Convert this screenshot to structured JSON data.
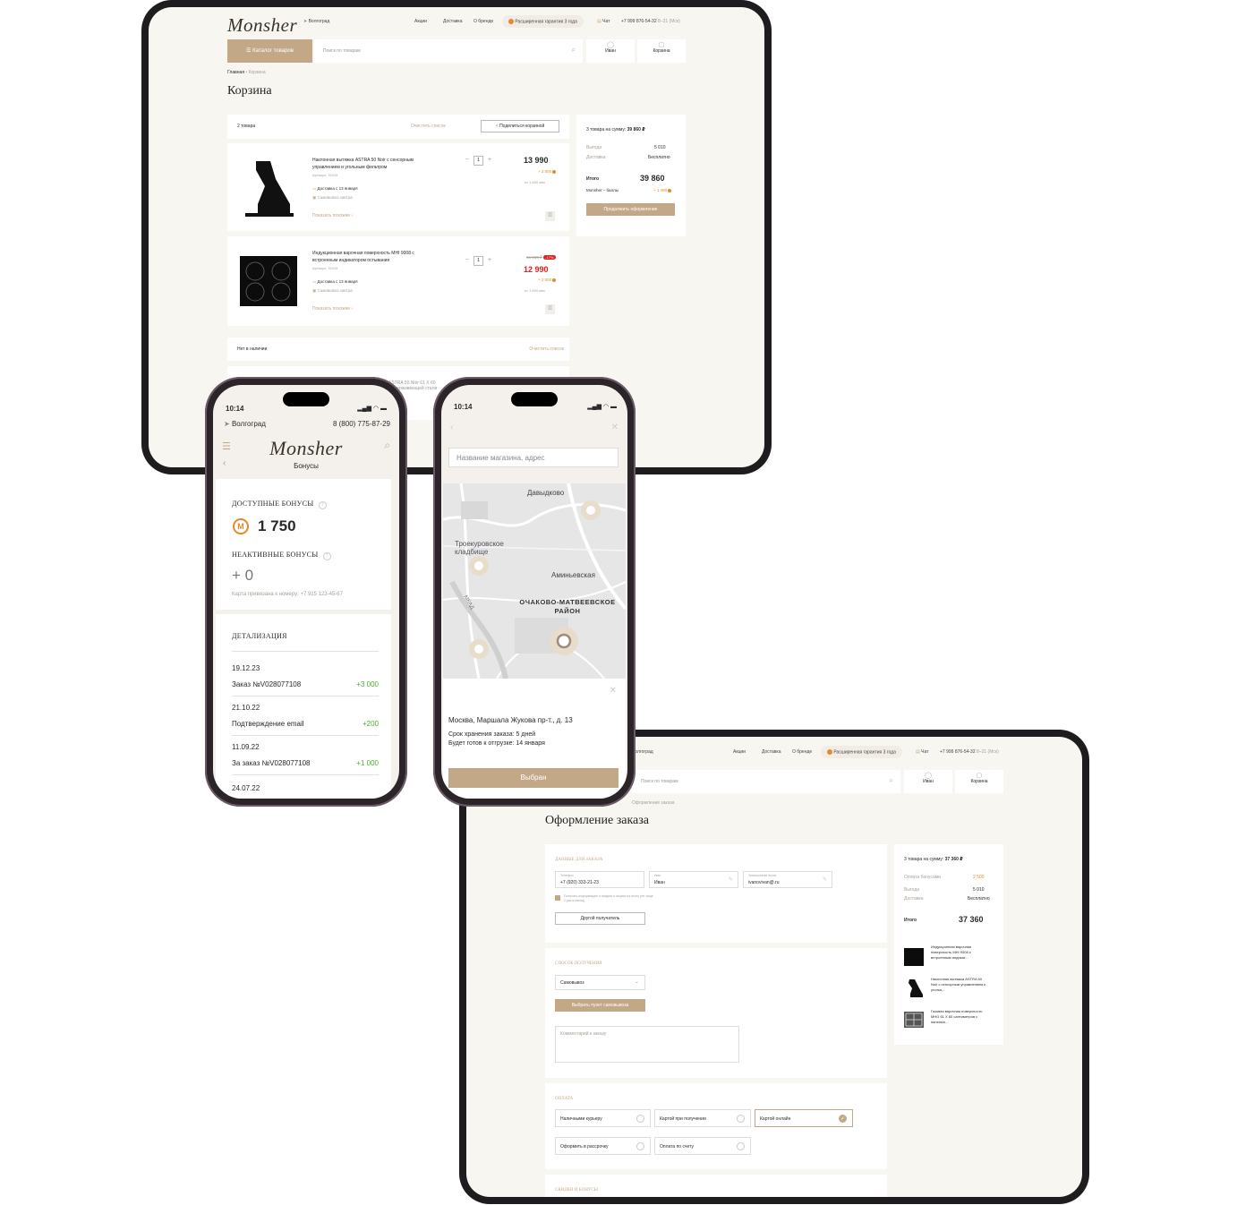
{
  "cart_page": {
    "logo": "Monsher",
    "city": "Волгоград",
    "nav": [
      "Акции",
      "Доставка",
      "О бренде"
    ],
    "warranty": "Расширенная гарантия 3 года",
    "chat": "Чат",
    "phone": "+7 999 876-54-32",
    "hours": "8–21 (Мск)",
    "catalog": "Каталог товаров",
    "search_placeholder": "Поиск по товарам",
    "user": "Иван",
    "cart": "Корзина",
    "breadcrumb_home": "Главная",
    "breadcrumb_current": "Корзина",
    "title": "Корзина",
    "items_count": "2 товара",
    "clear_list": "Очистить список",
    "share_cart": "Поделиться корзиной",
    "items": [
      {
        "name": "Наклонная вытяжка ASTRA 50 Noir с сенсорным управлением и угольным фильтром",
        "sku": "Артикул: 76243",
        "delivery": "Доставка с 13 января",
        "pickup": "Самовывоз завтра",
        "similar": "Показать похожие",
        "qty": "1",
        "price": "13 990",
        "old_price": "",
        "discount": "",
        "bonus": "+ 2 000",
        "installment": "от 1 890 мес"
      },
      {
        "name": "Индукционная варочная поверхность MHI 9008 с встроенным индикатором остывания",
        "sku": "Артикул: 76243",
        "delivery": "Доставка с 13 января",
        "pickup": "Самовывоз завтра",
        "similar": "Показать похожие",
        "qty": "1",
        "price": "12 990",
        "old_price": "16 990 ₽",
        "discount": "-17%",
        "bonus": "+ 2 000",
        "installment": "от 1 890 мес"
      }
    ],
    "not_available": "Нет в наличии",
    "clear_list_2": "Очистить список",
    "summary": {
      "total_label": "3 товара на сумму:",
      "total_value": "39 860 ₽",
      "benefit_label": "Выгода",
      "benefit_value": "5 010",
      "delivery_label": "Доставка",
      "delivery_value": "Бесплатно",
      "itogo_label": "Итого",
      "itogo_value": "39 860",
      "bonus_label": "Monsher – баллы",
      "bonus_value": "+ 1 490",
      "continue": "Продолжить оформление"
    },
    "peek_text_1": "ASTRA 50 Noir 61 X 60",
    "peek_text_2": "из нержавеющей стали"
  },
  "phone_bonus": {
    "time": "10:14",
    "city": "Волгоград",
    "phone": "8 (800) 775-87-29",
    "logo": "Monsher",
    "subtitle": "Бонусы",
    "available_label": "доступные бонусы",
    "available_value": "1 750",
    "inactive_label": "неактивные бонусы",
    "inactive_value": "+ 0",
    "card_bound": "Карта привязана к номеру: +7 915 123-45-67",
    "details_label": "детализация",
    "transactions": [
      {
        "date": "19.12.23",
        "title": "Заказ №V028077108",
        "amount": "+3 000"
      },
      {
        "date": "21.10.22",
        "title": "Подтверждение email",
        "amount": "+200"
      },
      {
        "date": "11.09.22",
        "title": "За заказ №V028077108",
        "amount": "+1 000"
      },
      {
        "date": "24.07.22",
        "title": "",
        "amount": ""
      }
    ]
  },
  "phone_map": {
    "time": "10:14",
    "search_placeholder": "Название магазина, адрес",
    "map_labels": [
      "Давыдково",
      "Троекуровское кладбище",
      "Аминьевская",
      "ОЧАКОВО-МАТВЕЕВСКОЕ РАЙОН",
      "МКАД"
    ],
    "address": "Москва, Маршала Жукова пр-т., д. 13",
    "storage": "Срок хранения заказа: 5 дней",
    "ready": "Будет готов к отгрузке: 14 января",
    "selected": "Выбран"
  },
  "checkout_page": {
    "city": "Волгоград",
    "nav": [
      "Акции",
      "Доставка",
      "О бренде"
    ],
    "warranty": "Расширенная гарантия 3 года",
    "chat": "Чат",
    "phone": "+7 999 876-54-32",
    "hours": "8–21 (Мск)",
    "search_placeholder": "Поиск по товарам",
    "user": "Иван",
    "cart": "Корзина",
    "breadcrumb": "Оформление заказа",
    "title": "Оформление заказа",
    "contact_section": "данные для заказа",
    "phone_label": "Телефон",
    "phone_value": "+7 (920) 333-21-23",
    "name_label": "Имя",
    "name_value": "Иван",
    "email_label": "Электронная почта",
    "email_value": "ivanovivan@.ru",
    "consent": "Получать информацию о скидках и акциях на почту (не чаще 2 раз в месяц)",
    "other_recipient": "Другой получатель",
    "receive_section": "способ получения",
    "receive_value": "Самовывоз",
    "choose_point": "Выбрать пункт самовывоза",
    "comment_placeholder": "Комментарий к заказу",
    "payment_section": "оплата",
    "payments": [
      "Наличными курьеру",
      "Картой при получении",
      "Картой онлайн",
      "Оформить в рассрочку",
      "Оплата по счету"
    ],
    "discounts_section": "скидки и бонусы",
    "summary": {
      "total_label": "3 товара на сумму:",
      "total_value": "37 360 ₽",
      "bonus_pay_label": "Оплата бонусами",
      "bonus_pay_value": "2 500",
      "benefit_label": "Выгода",
      "benefit_value": "5 010",
      "delivery_label": "Доставка",
      "delivery_value": "Бесплатно",
      "itogo_label": "Итого",
      "itogo_value": "37 360"
    },
    "order_items": [
      "Индукционная варочная поверхность MHI 9008 с встроенным индикат...",
      "Наклонная вытяжка ASTRA 50 Noir с сенсорным управлением и угольн...",
      "Газовая варочная поверхность MHG 61 X 60 сантиметров с панелью..."
    ]
  }
}
